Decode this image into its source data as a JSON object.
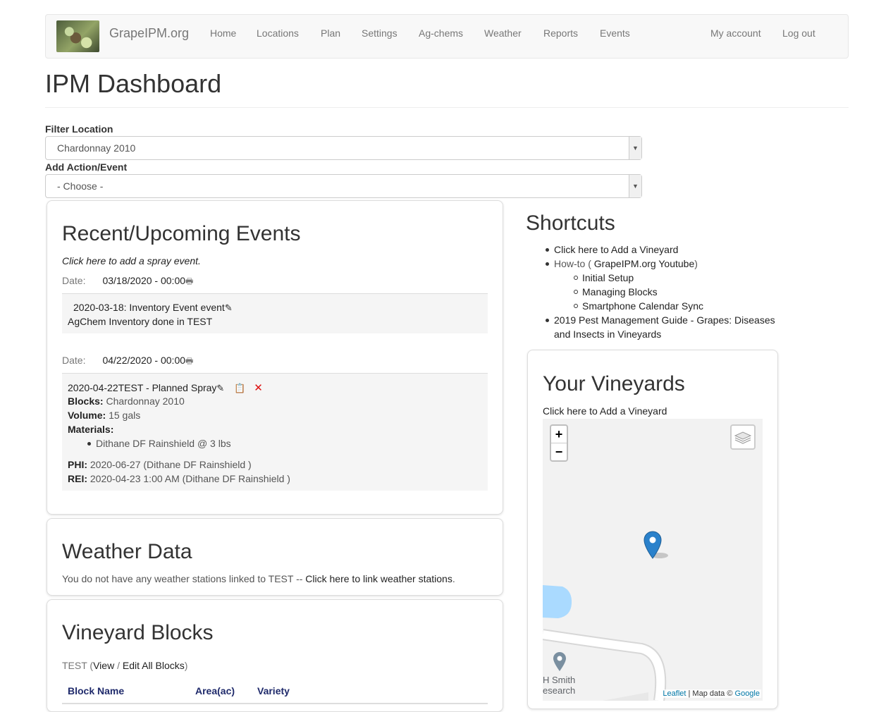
{
  "navbar": {
    "brand": "GrapeIPM.org",
    "items": [
      "Home",
      "Locations",
      "Plan",
      "Settings",
      "Ag-chems",
      "Weather",
      "Reports",
      "Events"
    ],
    "right_items": [
      "My account",
      "Log out"
    ]
  },
  "page_title": "IPM Dashboard",
  "filter": {
    "label": "Filter Location",
    "value": "Chardonnay 2010"
  },
  "add_action": {
    "label": "Add Action/Event",
    "value": "- Choose -"
  },
  "events_panel": {
    "title": "Recent/Upcoming Events",
    "add_spray_link": "Click here to add a spray event.",
    "groups": [
      {
        "date_label": "Date:",
        "date_value": "03/18/2020 - 00:00",
        "event_title": "2020-03-18: Inventory Event event",
        "event_detail": "AgChem Inventory done in TEST"
      },
      {
        "date_label": "Date:",
        "date_value": "04/22/2020 - 00:00",
        "event_title": "2020-04-22TEST - Planned Spray",
        "blocks_label": "Blocks:",
        "blocks_value": "Chardonnay 2010",
        "volume_label": "Volume:",
        "volume_value": "15 gals",
        "materials_label": "Materials:",
        "materials": [
          "Dithane DF Rainshield @ 3 lbs"
        ],
        "phi_label": "PHI:",
        "phi_value": "2020-06-27 (Dithane DF Rainshield )",
        "rei_label": "REI:",
        "rei_value": "2020-04-23 1:00 AM (Dithane DF Rainshield )"
      }
    ]
  },
  "weather_panel": {
    "title": "Weather Data",
    "text": "You do not have any weather stations linked to TEST -- ",
    "link": "Click here to link weather stations",
    "period": "."
  },
  "blocks_panel": {
    "title": "Vineyard Blocks",
    "location": "TEST",
    "open_paren": " (",
    "view_link": "View",
    "slash": " / ",
    "edit_link": "Edit All Blocks",
    "close_paren": ")",
    "columns": [
      "Block Name",
      "Area(ac)",
      "Variety"
    ]
  },
  "shortcuts": {
    "title": "Shortcuts",
    "add_vineyard": "Click here to Add a Vineyard",
    "howto_prefix": "How-to ( ",
    "howto_link": "GrapeIPM.org Youtube",
    "howto_suffix": ")",
    "howto_items": [
      "Initial Setup",
      "Managing Blocks",
      "Smartphone Calendar Sync"
    ],
    "guide_line1": "2019 Pest Management Guide - Grapes: Diseases",
    "guide_line2": "and Insects in Vineyards"
  },
  "vineyards_panel": {
    "title": "Your Vineyards",
    "add_link": "Click here to Add a Vineyard",
    "map": {
      "zoom_in": "+",
      "zoom_out": "−",
      "poi_label_line1": "H Smith",
      "poi_label_line2": "esearch",
      "credit_leaflet": "Leaflet",
      "credit_sep": " | Map data © ",
      "credit_google": "Google",
      "colors": {
        "water": "#aadaff",
        "road": "#ffffff",
        "marker": "#2a81cb",
        "poi": "#7a8fa0"
      }
    }
  }
}
